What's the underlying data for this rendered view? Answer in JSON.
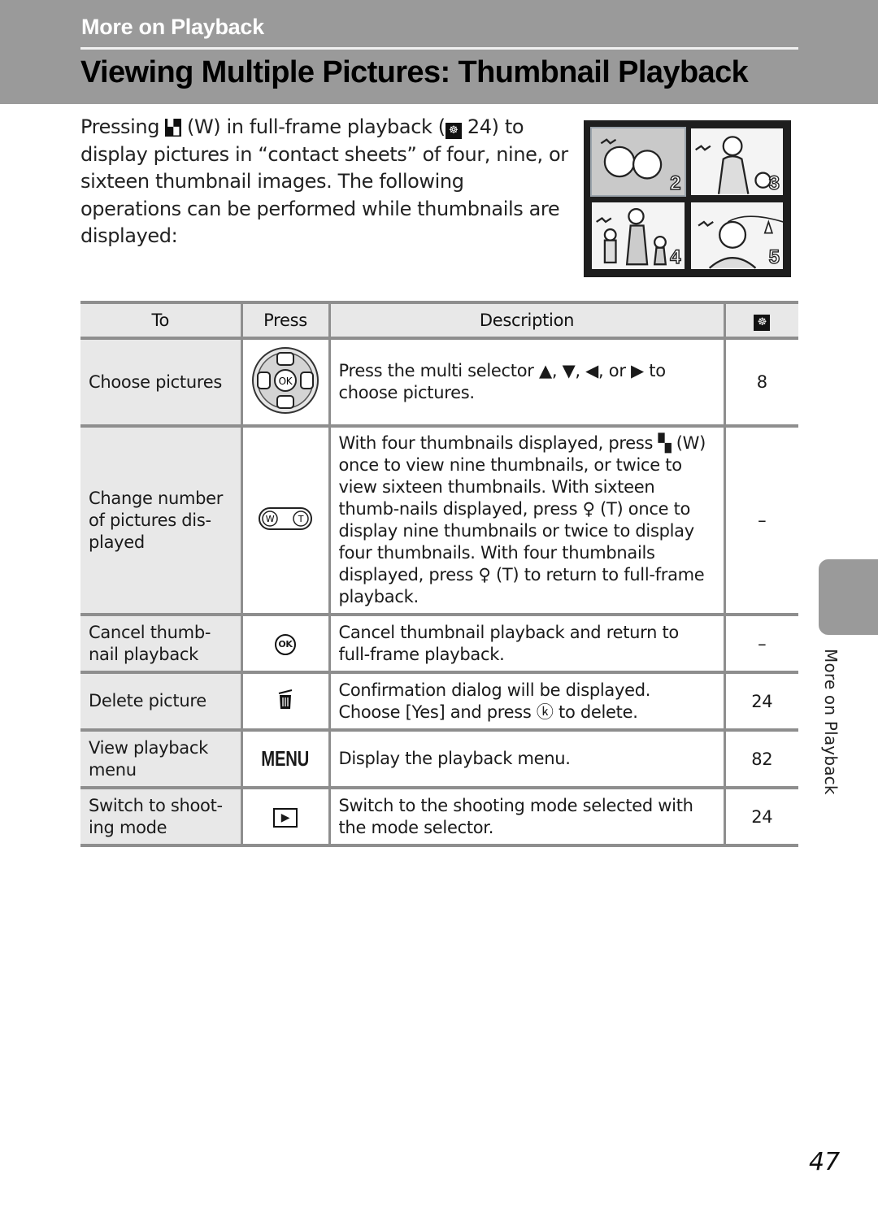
{
  "header": {
    "section": "More on Playback",
    "title": "Viewing Multiple Pictures: Thumbnail Playback"
  },
  "intro": {
    "part1": "Pressing",
    "thumb_glyph": "▚",
    "part2": "(W) in full-frame playback (",
    "ref_glyph": "☸",
    "part3": " 24) to display pictures in “contact sheets” of four, nine, or sixteen thumbnail images. The following operations can be performed while thumbnails are displayed:"
  },
  "thumbnails": [
    {
      "number": "2",
      "subject": "flowers",
      "selected": true
    },
    {
      "number": "3",
      "subject": "woman-with-child"
    },
    {
      "number": "4",
      "subject": "family-walking"
    },
    {
      "number": "5",
      "subject": "portrait-by-lake"
    }
  ],
  "table": {
    "headers": {
      "to": "To",
      "press": "Press",
      "description": "Description",
      "page_icon": "reference-icon"
    },
    "rows": [
      {
        "to": "Choose pictures",
        "press_icon": "multi-selector-icon",
        "description": "Press the multi selector ▲, ▼, ◀, or ▶ to choose pictures.",
        "page": "8"
      },
      {
        "to": "Change number of pictures dis-played",
        "press_icon": "zoom-w-t-icon",
        "press_text_w": "W",
        "press_text_t": "T",
        "description": "With four thumbnails displayed, press ▚ (W) once to view nine thumbnails, or twice to view sixteen thumbnails. With sixteen thumb-nails displayed, press ♀ (T) once to display nine thumbnails or twice to display four thumbnails. With four thumbnails displayed, press ♀ (T) to return to full-frame playback.",
        "page": "–"
      },
      {
        "to": "Cancel thumb-nail playback",
        "press_icon": "ok-button-icon",
        "press_text": "OK",
        "description": "Cancel thumbnail playback and return to full-frame playback.",
        "page": "–"
      },
      {
        "to": "Delete picture",
        "press_icon": "trash-icon",
        "press_text": "🗑",
        "description": "Confirmation dialog will be displayed. Choose [Yes] and press ⓚ to delete.",
        "page": "24"
      },
      {
        "to": "View playback menu",
        "press_icon": "menu-button-icon",
        "press_text": "MENU",
        "description": "Display the playback menu.",
        "page": "82"
      },
      {
        "to": "Switch to shoot-ing mode",
        "press_icon": "play-button-icon",
        "press_text": "▶",
        "description": "Switch to the shooting mode selected with the mode selector.",
        "page": "24"
      }
    ]
  },
  "side_tab": {
    "label": "More on Playback"
  },
  "page_number": "47"
}
